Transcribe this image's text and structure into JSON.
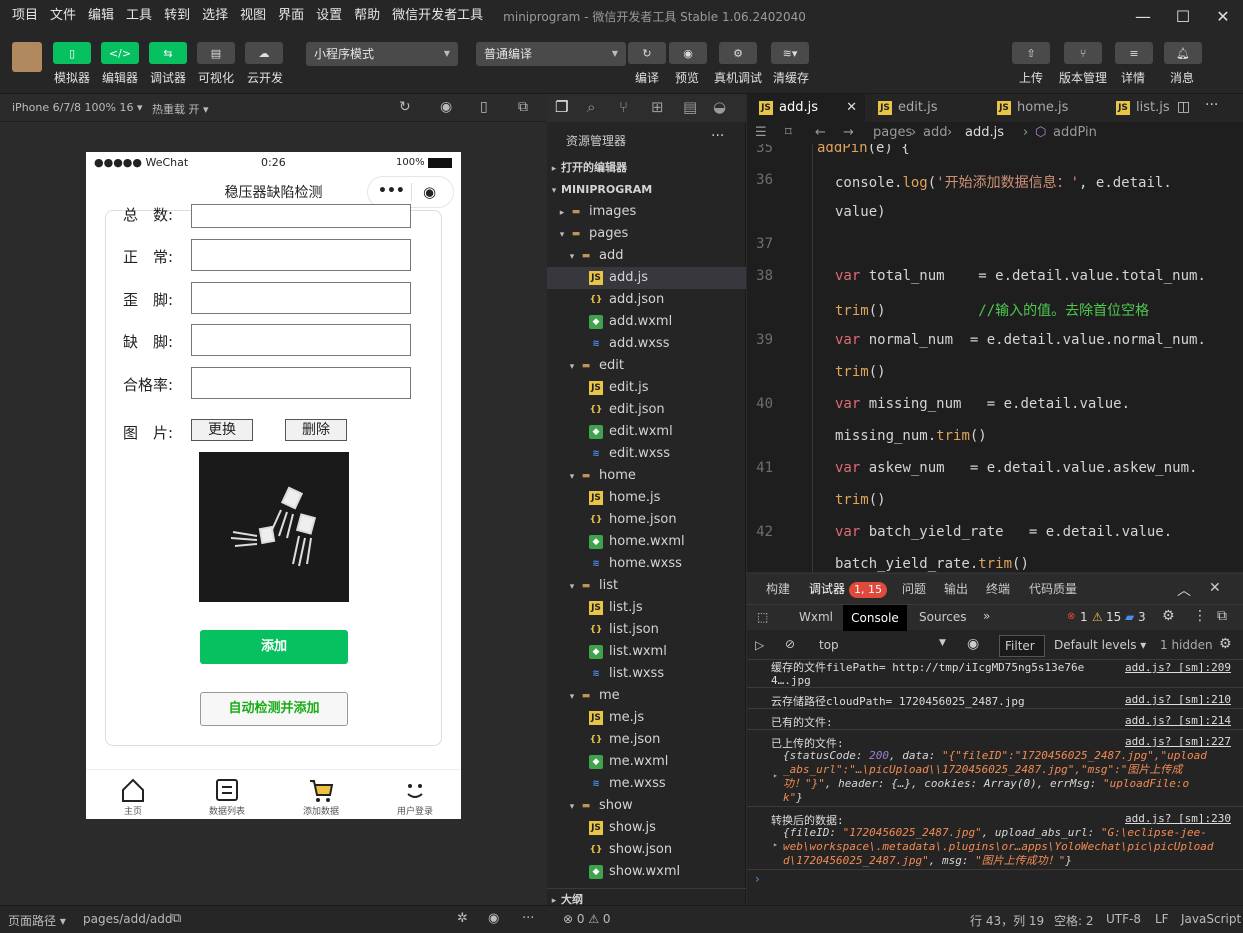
{
  "menubar": {
    "items": [
      "项目",
      "文件",
      "编辑",
      "工具",
      "转到",
      "选择",
      "视图",
      "界面",
      "设置",
      "帮助",
      "微信开发者工具"
    ],
    "title": "miniprogram - 微信开发者工具 Stable 1.06.2402040"
  },
  "toolbar": {
    "left": [
      "模拟器",
      "编辑器",
      "调试器",
      "可视化",
      "云开发"
    ],
    "mode": "小程序模式",
    "compile": "普通编译",
    "mid": [
      "编译",
      "预览",
      "真机调试",
      "清缓存"
    ],
    "right": [
      "上传",
      "版本管理",
      "详情",
      "消息"
    ]
  },
  "simbar": {
    "device": "iPhone 6/7/8 100% 16 ▾",
    "hotreload": "热重载 开 ▾"
  },
  "phone": {
    "carrier": "●●●●● WeChat",
    "time": "0:26",
    "battery": "100%",
    "title": "稳压器缺陷检测",
    "labels": [
      "总　数:",
      "正　常:",
      "歪　脚:",
      "缺　脚:",
      "合格率:"
    ],
    "image_label": "图　片:",
    "replace": "更换",
    "delete": "删除",
    "add": "添加",
    "auto_add": "自动检测并添加",
    "tabs": [
      "主页",
      "数据列表",
      "添加数据",
      "用户登录"
    ]
  },
  "explorer": {
    "title": "资源管理器",
    "open_editors": "打开的编辑器",
    "project": "MINIPROGRAM",
    "outline": "大纲",
    "tree": [
      {
        "t": "images",
        "d": 1,
        "k": "folder",
        "a": "▸"
      },
      {
        "t": "pages",
        "d": 1,
        "k": "folder",
        "a": "▾"
      },
      {
        "t": "add",
        "d": 2,
        "k": "folder",
        "a": "▾"
      },
      {
        "t": "add.js",
        "d": 3,
        "k": "js",
        "sel": true
      },
      {
        "t": "add.json",
        "d": 3,
        "k": "json"
      },
      {
        "t": "add.wxml",
        "d": 3,
        "k": "wxml"
      },
      {
        "t": "add.wxss",
        "d": 3,
        "k": "wxss"
      },
      {
        "t": "edit",
        "d": 2,
        "k": "folder",
        "a": "▾"
      },
      {
        "t": "edit.js",
        "d": 3,
        "k": "js"
      },
      {
        "t": "edit.json",
        "d": 3,
        "k": "json"
      },
      {
        "t": "edit.wxml",
        "d": 3,
        "k": "wxml"
      },
      {
        "t": "edit.wxss",
        "d": 3,
        "k": "wxss"
      },
      {
        "t": "home",
        "d": 2,
        "k": "folder",
        "a": "▾"
      },
      {
        "t": "home.js",
        "d": 3,
        "k": "js"
      },
      {
        "t": "home.json",
        "d": 3,
        "k": "json"
      },
      {
        "t": "home.wxml",
        "d": 3,
        "k": "wxml"
      },
      {
        "t": "home.wxss",
        "d": 3,
        "k": "wxss"
      },
      {
        "t": "list",
        "d": 2,
        "k": "folder",
        "a": "▾"
      },
      {
        "t": "list.js",
        "d": 3,
        "k": "js"
      },
      {
        "t": "list.json",
        "d": 3,
        "k": "json"
      },
      {
        "t": "list.wxml",
        "d": 3,
        "k": "wxml"
      },
      {
        "t": "list.wxss",
        "d": 3,
        "k": "wxss"
      },
      {
        "t": "me",
        "d": 2,
        "k": "folder",
        "a": "▾"
      },
      {
        "t": "me.js",
        "d": 3,
        "k": "js"
      },
      {
        "t": "me.json",
        "d": 3,
        "k": "json"
      },
      {
        "t": "me.wxml",
        "d": 3,
        "k": "wxml"
      },
      {
        "t": "me.wxss",
        "d": 3,
        "k": "wxss"
      },
      {
        "t": "show",
        "d": 2,
        "k": "folder",
        "a": "▾"
      },
      {
        "t": "show.js",
        "d": 3,
        "k": "js"
      },
      {
        "t": "show.json",
        "d": 3,
        "k": "json"
      },
      {
        "t": "show.wxml",
        "d": 3,
        "k": "wxml"
      }
    ]
  },
  "editor": {
    "tabs": [
      "add.js",
      "edit.js",
      "home.js",
      "list.js"
    ],
    "crumbs": [
      "pages",
      "add",
      "add.js",
      "addPin"
    ]
  },
  "debug": {
    "tabs": [
      "构建",
      "调试器",
      "问题",
      "输出",
      "终端",
      "代码质量"
    ],
    "badge": "1, 15",
    "ctabs": [
      "Wxml",
      "Console",
      "Sources"
    ],
    "errors": "1",
    "warnings": "15",
    "infos": "3",
    "context": "top",
    "filter": "Filter",
    "levels": "Default levels ▾",
    "hidden": "1 hidden",
    "logs": [
      {
        "msg": "缓存的文件filePath= http://tmp/iIcgMD75ng5s13e76e\n4….jpg",
        "src": "add.js? [sm]:209"
      },
      {
        "msg": "云存储路径cloudPath= 1720456025_2487.jpg",
        "src": "add.js? [sm]:210"
      },
      {
        "msg": "已有的文件:",
        "src": "add.js? [sm]:214"
      },
      {
        "msg": "已上传的文件:",
        "src": "add.js? [sm]:227"
      },
      {
        "msg": "转换后的数据:",
        "src": "add.js? [sm]:230"
      }
    ]
  },
  "statusbar": {
    "path_label": "页面路径 ▾",
    "path": "pages/add/add",
    "problems": "⊗ 0 ⚠ 0",
    "pos": "行 43，列 19",
    "indent": "空格: 2",
    "enc": "UTF-8",
    "eol": "LF",
    "lang": "JavaScript"
  },
  "colors": {
    "green": "#07c160",
    "bg": "#2b2b2b",
    "editor": "#1e1e1e"
  }
}
